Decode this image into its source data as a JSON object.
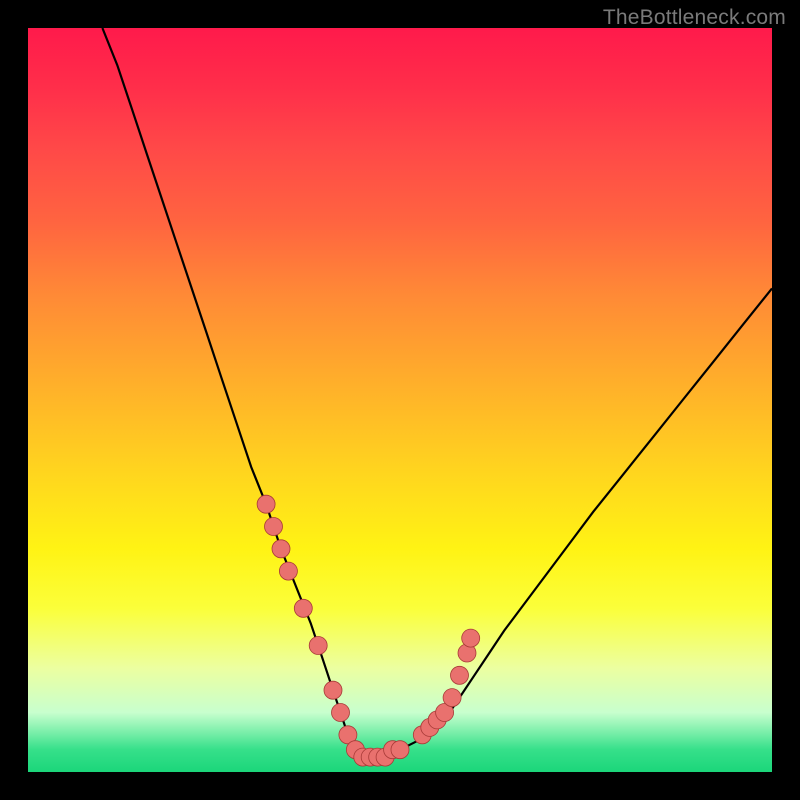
{
  "watermark": "TheBottleneck.com",
  "chart_data": {
    "type": "line",
    "title": "",
    "xlabel": "",
    "ylabel": "",
    "xlim": [
      0,
      100
    ],
    "ylim": [
      0,
      100
    ],
    "grid": false,
    "legend": false,
    "series": [
      {
        "name": "bottleneck-curve",
        "x": [
          10,
          12,
          14,
          16,
          18,
          20,
          22,
          24,
          26,
          28,
          30,
          32,
          34,
          36,
          38,
          39,
          40,
          41,
          42,
          43,
          44,
          45,
          46,
          47,
          48,
          49,
          50,
          52,
          54,
          56,
          58,
          60,
          62,
          64,
          67,
          70,
          73,
          76,
          80,
          84,
          88,
          92,
          96,
          100
        ],
        "y": [
          100,
          95,
          89,
          83,
          77,
          71,
          65,
          59,
          53,
          47,
          41,
          36,
          30,
          25,
          20,
          17,
          14,
          11,
          8,
          5,
          3,
          2,
          2,
          2,
          2,
          3,
          3,
          4,
          5,
          7,
          10,
          13,
          16,
          19,
          23,
          27,
          31,
          35,
          40,
          45,
          50,
          55,
          60,
          65
        ]
      }
    ],
    "markers": {
      "name": "highlight-points",
      "x": [
        32,
        33,
        34,
        35,
        37,
        39,
        41,
        42,
        43,
        44,
        45,
        46,
        47,
        48,
        49,
        50,
        53,
        54,
        55,
        56,
        57,
        58,
        59,
        59.5
      ],
      "y": [
        36,
        33,
        30,
        27,
        22,
        17,
        11,
        8,
        5,
        3,
        2,
        2,
        2,
        2,
        3,
        3,
        5,
        6,
        7,
        8,
        10,
        13,
        16,
        18
      ]
    },
    "band": {
      "name": "green-band",
      "ymin": 0,
      "ymax": 3
    }
  }
}
